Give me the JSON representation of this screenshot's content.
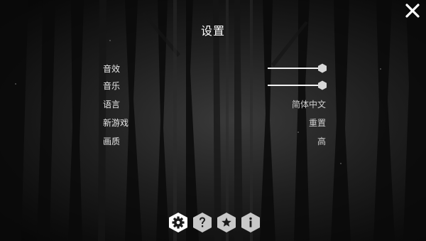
{
  "title": "设置",
  "settings": {
    "sound_effects": {
      "label": "音效",
      "level": 1.0
    },
    "music": {
      "label": "音乐",
      "level": 1.0
    },
    "language": {
      "label": "语言",
      "value": "简体中文"
    },
    "new_game": {
      "label": "新游戏",
      "value": "重置"
    },
    "quality": {
      "label": "画质",
      "value": "高"
    }
  },
  "bottom_icons": [
    "gear-icon",
    "help-icon",
    "star-icon",
    "info-icon"
  ],
  "colors": {
    "text": "#e8e8e8",
    "accent": "#ffffff",
    "hex_active_bg": "#ffffff",
    "hex_inactive_bg": "#c8c8c8",
    "hex_glyph": "#1a1a1a"
  }
}
